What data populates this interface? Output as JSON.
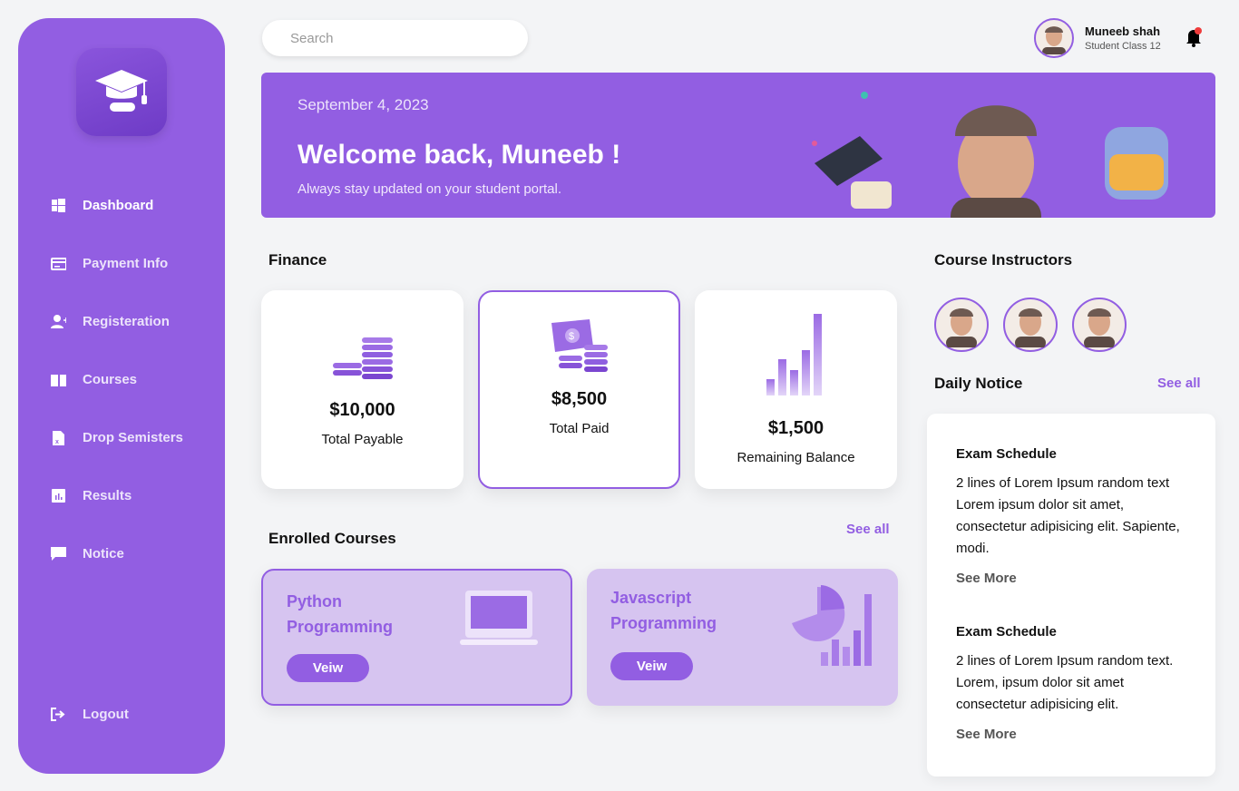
{
  "sidebar": {
    "items": [
      {
        "label": "Dashboard",
        "icon": "windows-icon"
      },
      {
        "label": "Payment Info",
        "icon": "credit-card-icon"
      },
      {
        "label": "Registeration",
        "icon": "user-plus-icon"
      },
      {
        "label": "Courses",
        "icon": "book-icon"
      },
      {
        "label": "Drop Semisters",
        "icon": "file-x-icon"
      },
      {
        "label": "Results",
        "icon": "chart-icon"
      },
      {
        "label": "Notice",
        "icon": "message-icon"
      }
    ],
    "logout": "Logout"
  },
  "search": {
    "placeholder": "Search"
  },
  "user": {
    "name": "Muneeb shah",
    "class": "Student Class 12"
  },
  "banner": {
    "date": "September 4, 2023",
    "title": "Welcome back, Muneeb !",
    "subtitle": "Always stay updated on your student portal."
  },
  "finance": {
    "title": "Finance",
    "cards": [
      {
        "amount": "$10,000",
        "label": "Total Payable"
      },
      {
        "amount": "$8,500",
        "label": "Total Paid"
      },
      {
        "amount": "$1,500",
        "label": "Remaining Balance"
      }
    ]
  },
  "courses": {
    "title": "Enrolled Courses",
    "see_all": "See all",
    "items": [
      {
        "line1": "Python",
        "line2": "Programming",
        "button": "Veiw"
      },
      {
        "line1": "Javascript",
        "line2": "Programming",
        "button": "Veiw"
      }
    ]
  },
  "instructors": {
    "title": "Course Instructors"
  },
  "notice": {
    "title": "Daily Notice",
    "see_all": "See all",
    "items": [
      {
        "title": "Exam Schedule",
        "text": "2 lines of Lorem Ipsum random text Lorem ipsum dolor sit amet, consectetur adipisicing elit. Sapiente, modi.",
        "more": "See More"
      },
      {
        "title": "Exam Schedule",
        "text": "2 lines of Lorem Ipsum random text. Lorem, ipsum dolor sit amet consectetur adipisicing elit.",
        "more": "See More"
      }
    ]
  },
  "colors": {
    "accent": "#925ee2",
    "background": "#f3f4f6"
  }
}
